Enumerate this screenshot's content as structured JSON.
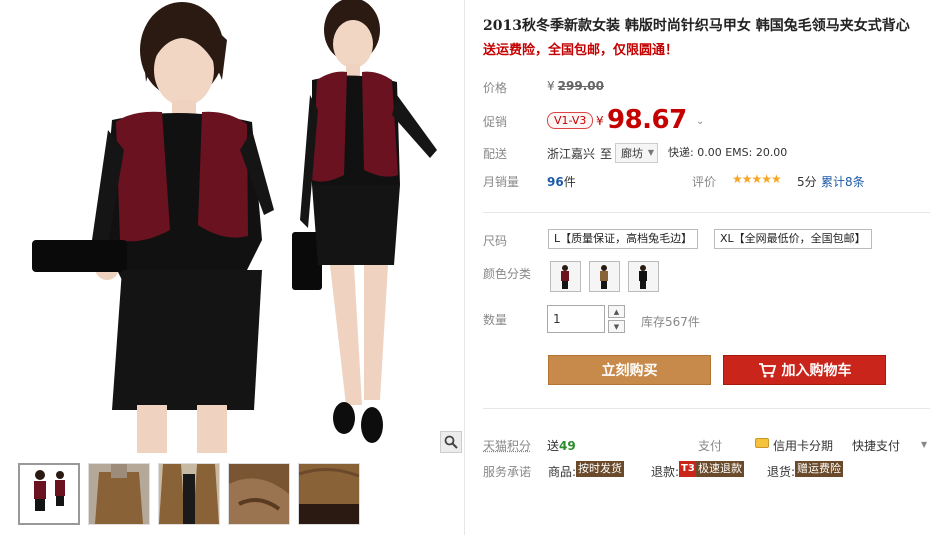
{
  "product": {
    "title": "2013秋冬季新款女装 韩版时尚针织马甲女 韩国兔毛领马夹女式背心",
    "subtitle": "送运费险，全国包邮，仅限圆通！"
  },
  "pricing": {
    "price_label": "价格",
    "currency_symbol": "¥",
    "original_price": "299.00",
    "promo_label": "促销",
    "promo_tag": "V1-V3",
    "promo_price": "98.67"
  },
  "shipping": {
    "label": "配送",
    "from": "浙江嘉兴",
    "to": "至",
    "destination": "廊坊",
    "fee_text": "快递: 0.00 EMS: 20.00"
  },
  "sales": {
    "label": "月销量",
    "count": "96",
    "unit": "件",
    "review_label": "评价",
    "stars": "★★★★★",
    "score": "5分",
    "review_count": "累计8条"
  },
  "options": {
    "size_label": "尺码",
    "sizes": [
      "L【质量保证，高档兔毛边】",
      "XL【全网最低价，全国包邮】"
    ],
    "color_label": "颜色分类",
    "color_swatch_count": 3
  },
  "quantity": {
    "label": "数量",
    "value": "1",
    "stock": "库存567件"
  },
  "actions": {
    "buy_now": "立刻购买",
    "add_to_cart": "加入购物车"
  },
  "footer": {
    "points_label": "天猫积分",
    "points_prefix": "送",
    "points_value": "49",
    "pay_label": "支付",
    "credit_label": "信用卡分期",
    "quick_pay": "快捷支付",
    "service_label": "服务承诺",
    "goods_label": "商品:",
    "goods_badge": "按时发货",
    "refund_label": "退款:",
    "refund_t3": "T3",
    "refund_badge": "极速退款",
    "return_label": "退货:",
    "return_badge": "赠运费险"
  },
  "colors": {
    "accent_red": "#c40000",
    "buy_now_bg": "#c88a4a",
    "cart_bg": "#c9251b",
    "link_blue": "#1d5ba8",
    "star": "#f5a623",
    "vest_wine": "#6b1220"
  },
  "icons": {
    "zoom": "magnifier-icon",
    "cart": "cart-icon",
    "credit": "credit-card-icon"
  }
}
